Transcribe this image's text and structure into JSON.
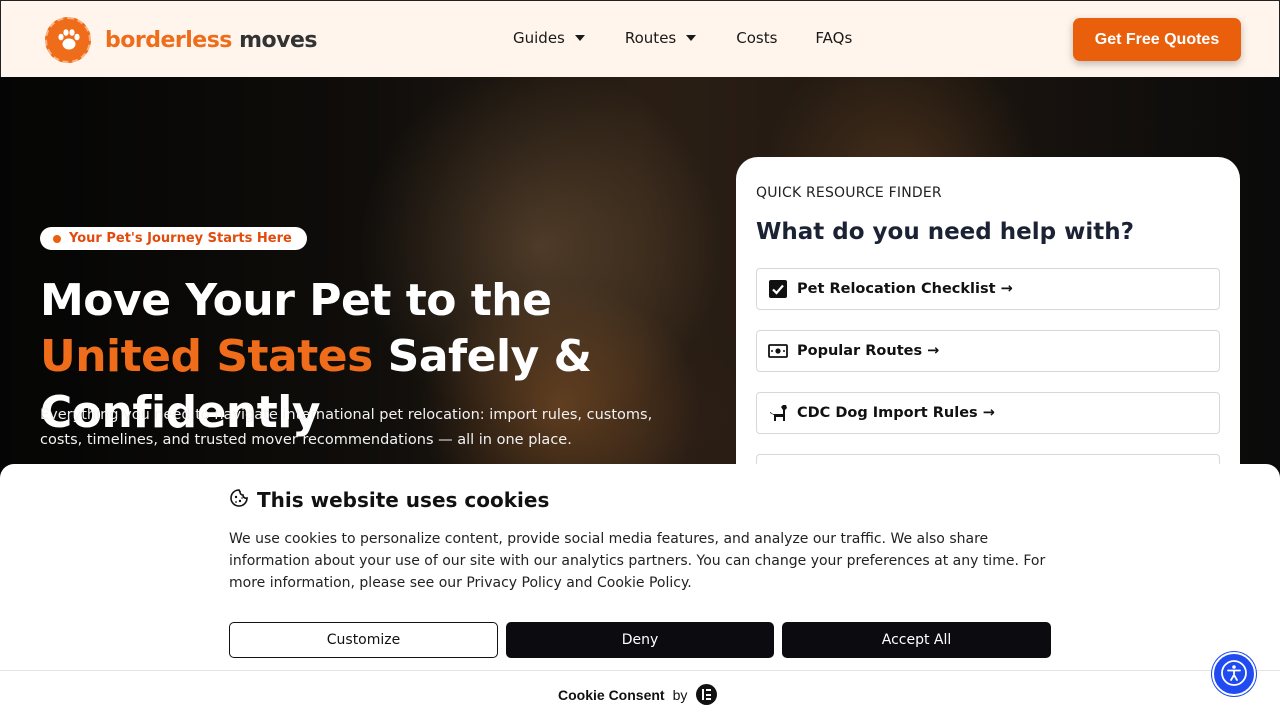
{
  "header": {
    "logo": {
      "part1": "borderless",
      "part2": "moves",
      "icon": "paw-plane-icon"
    },
    "nav": [
      {
        "label": "Guides",
        "has_dropdown": true
      },
      {
        "label": "Routes",
        "has_dropdown": true
      },
      {
        "label": "Costs",
        "has_dropdown": false
      },
      {
        "label": "FAQs",
        "has_dropdown": false
      }
    ],
    "cta_label": "Get Free Quotes"
  },
  "hero": {
    "badge": "Your Pet's Journey Starts Here",
    "title_part1": "Move Your Pet to the ",
    "title_accent": "United States",
    "title_part2": " Safely & Confidently",
    "subtitle": "Everything you need to navigate international pet relocation: import rules, customs, costs, timelines, and trusted mover recommendations — all in one place."
  },
  "finder": {
    "eyebrow": "QUICK RESOURCE FINDER",
    "title": "What do you need help with?",
    "items": [
      {
        "label": "Pet Relocation Checklist →",
        "icon": "checkbox-icon"
      },
      {
        "label": "Popular Routes →",
        "icon": "money-icon"
      },
      {
        "label": "CDC Dog Import Rules →",
        "icon": "dog-icon"
      },
      {
        "label": "",
        "icon": ""
      }
    ]
  },
  "cookie": {
    "title": "This website uses cookies",
    "text": "We use cookies to personalize content, provide social media features, and analyze our traffic. We also share information about your use of our site with our analytics partners. You can change your preferences at any time. For more information, please see our Privacy Policy and Cookie Policy.",
    "buttons": {
      "customize": "Customize",
      "deny": "Deny",
      "accept": "Accept All"
    },
    "footer_brand": "Cookie Consent",
    "footer_by": "by"
  },
  "colors": {
    "brand_orange": "#e95f0c",
    "header_bg": "#fff5ec",
    "dark_button": "#0c0c10",
    "a11y_blue": "#1f4bf0"
  }
}
